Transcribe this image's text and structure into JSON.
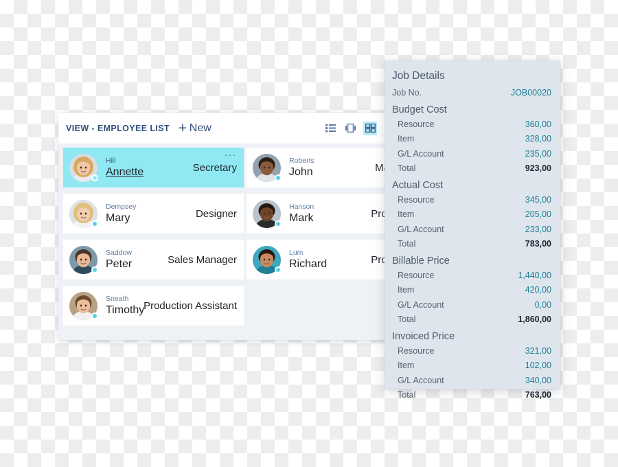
{
  "employee_list": {
    "title": "VIEW - EMPLOYEE LIST",
    "new_label": "New",
    "new_plus": "+",
    "view_modes": [
      {
        "name": "list-view",
        "label": "List view",
        "active": false
      },
      {
        "name": "card-view",
        "label": "Card view",
        "active": false
      },
      {
        "name": "grid-view",
        "label": "Grid view",
        "active": true
      }
    ],
    "overflow_dots": "···",
    "employees_left": [
      {
        "surname": "Hill",
        "firstname": "Annette",
        "role": "Secretary",
        "selected": true
      },
      {
        "surname": "Dempsey",
        "firstname": "Mary",
        "role": "Designer",
        "selected": false
      },
      {
        "surname": "Saddow",
        "firstname": "Peter",
        "role": "Sales Manager",
        "selected": false
      },
      {
        "surname": "Sneath",
        "firstname": "Timothy",
        "role": "Production Assistant",
        "selected": false
      }
    ],
    "employees_right": [
      {
        "surname": "Roberts",
        "firstname": "John",
        "role": "Managing",
        "selected": false
      },
      {
        "surname": "Hanson",
        "firstname": "Mark",
        "role": "Production",
        "selected": false
      },
      {
        "surname": "Lum",
        "firstname": "Richard",
        "role": "Production",
        "selected": false
      }
    ]
  },
  "job_panel": {
    "title": "Job Details",
    "job_no_label": "Job No.",
    "job_no_value": "JOB00020",
    "groups": [
      {
        "name": "Budget Cost",
        "rows": [
          {
            "label": "Resource",
            "value": "360,00",
            "total": false
          },
          {
            "label": "Item",
            "value": "328,00",
            "total": false
          },
          {
            "label": "G/L Account",
            "value": "235,00",
            "total": false
          },
          {
            "label": "Total",
            "value": "923,00",
            "total": true
          }
        ]
      },
      {
        "name": "Actual Cost",
        "rows": [
          {
            "label": "Resource",
            "value": "345,00",
            "total": false
          },
          {
            "label": "Item",
            "value": "205,00",
            "total": false
          },
          {
            "label": "G/L Account",
            "value": "233,00",
            "total": false
          },
          {
            "label": "Total",
            "value": "783,00",
            "total": true
          }
        ]
      },
      {
        "name": "Billable Price",
        "rows": [
          {
            "label": "Resource",
            "value": "1,440,00",
            "total": false
          },
          {
            "label": "Item",
            "value": "420,00",
            "total": false
          },
          {
            "label": "G/L Account",
            "value": "0,00",
            "total": false
          },
          {
            "label": "Total",
            "value": "1,860,00",
            "total": true
          }
        ]
      },
      {
        "name": "Invoiced Price",
        "rows": [
          {
            "label": "Resource",
            "value": "321,00",
            "total": false
          },
          {
            "label": "Item",
            "value": "102,00",
            "total": false
          },
          {
            "label": "G/L Account",
            "value": "340,00",
            "total": false
          },
          {
            "label": "Total",
            "value": "763,00",
            "total": true
          }
        ]
      }
    ]
  },
  "colors": {
    "accent_cyan": "#8fe8f2",
    "panel_bg": "#dfe5ec",
    "title_blue": "#31507e",
    "value_teal": "#1a7f96",
    "presence_dot": "#4fd3e8"
  }
}
